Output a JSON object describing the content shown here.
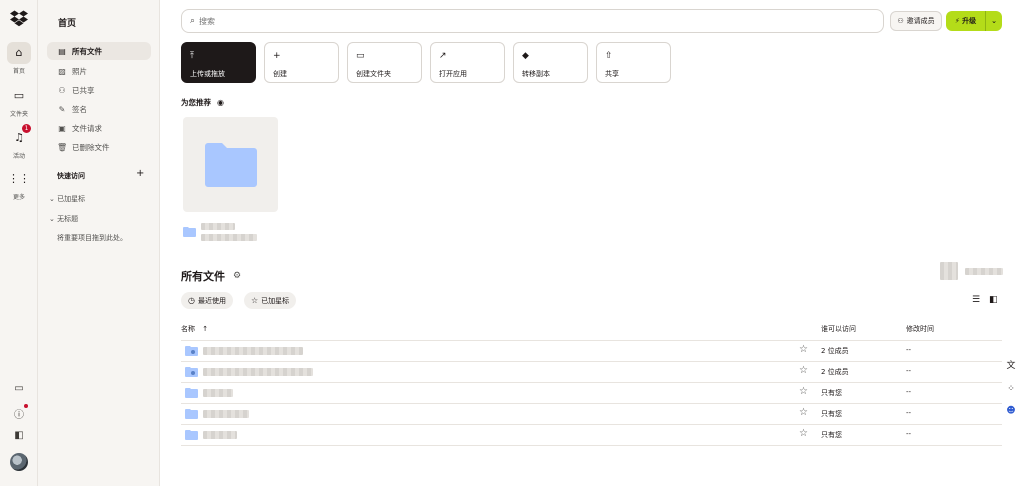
{
  "rail": {
    "items": [
      {
        "label": "首页",
        "icon": "home-icon"
      },
      {
        "label": "文件夹",
        "icon": "folder-icon"
      },
      {
        "label": "活动",
        "icon": "bell-icon",
        "badge": "1"
      },
      {
        "label": "更多",
        "icon": "grid-icon"
      }
    ]
  },
  "sidebar": {
    "title": "首页",
    "items": [
      {
        "label": "所有文件",
        "icon": "files-icon"
      },
      {
        "label": "照片",
        "icon": "photo-icon"
      },
      {
        "label": "已共享",
        "icon": "shared-icon"
      },
      {
        "label": "签名",
        "icon": "signature-icon"
      },
      {
        "label": "文件请求",
        "icon": "file-request-icon"
      },
      {
        "label": "已删除文件",
        "icon": "trash-icon"
      }
    ],
    "quick_access": "快速访问",
    "starred_group": "已加星标",
    "untitled_group": "无标题",
    "drag_hint": "将重要项目拖到此处。"
  },
  "search": {
    "placeholder": "搜索"
  },
  "header": {
    "invite": "邀请成员",
    "upgrade": "升级"
  },
  "actions": [
    {
      "label": "上传或拖放",
      "icon": "upload-icon"
    },
    {
      "label": "创建",
      "icon": "plus-icon"
    },
    {
      "label": "创建文件夹",
      "icon": "new-folder-icon"
    },
    {
      "label": "打开应用",
      "icon": "open-app-icon"
    },
    {
      "label": "转移副本",
      "icon": "transfer-icon"
    },
    {
      "label": "共享",
      "icon": "share-icon"
    }
  ],
  "recommended": {
    "title": "为您推荐"
  },
  "files": {
    "title": "所有文件",
    "chips": [
      {
        "label": "最近使用"
      },
      {
        "label": "已加星标"
      }
    ],
    "columns": {
      "name": "名称",
      "access": "谁可以访问",
      "modified": "修改时间"
    },
    "rows": [
      {
        "access": "2 位成员",
        "modified": "--",
        "shared": true
      },
      {
        "access": "2 位成员",
        "modified": "--",
        "shared": true
      },
      {
        "access": "只有您",
        "modified": "--",
        "shared": false
      },
      {
        "access": "只有您",
        "modified": "--",
        "shared": false
      },
      {
        "access": "只有您",
        "modified": "--",
        "shared": false
      }
    ]
  },
  "colors": {
    "accent": "#b4dc19",
    "folder": "#a9c7ff",
    "badge": "#c8102e"
  }
}
